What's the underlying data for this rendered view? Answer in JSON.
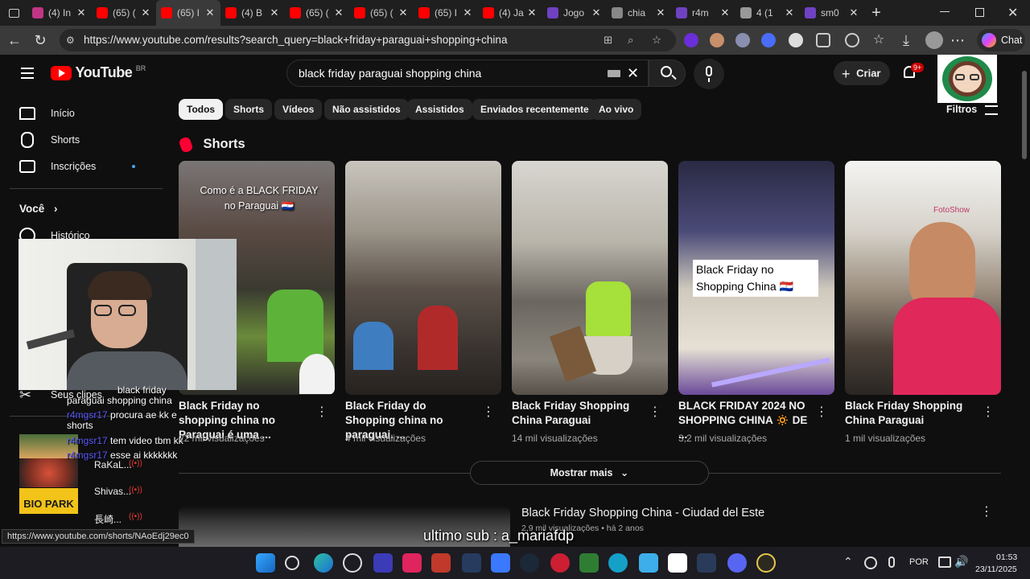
{
  "browser": {
    "tabs": [
      {
        "title": "(4) In",
        "color": "#c13584",
        "active": false
      },
      {
        "title": "(65) (",
        "color": "#ff0000",
        "active": false
      },
      {
        "title": "(65) I",
        "color": "#ff0000",
        "active": true
      },
      {
        "title": "(4) B",
        "color": "#ff0000",
        "active": false
      },
      {
        "title": "(65) (",
        "color": "#ff0000",
        "active": false
      },
      {
        "title": "(65) (",
        "color": "#ff0000",
        "active": false
      },
      {
        "title": "(65) I",
        "color": "#ff0000",
        "active": false
      },
      {
        "title": "(4) Ja",
        "color": "#ff0000",
        "active": false
      },
      {
        "title": "Jogo",
        "color": "#6f42c1",
        "active": false
      },
      {
        "title": "chia",
        "color": "#888888",
        "active": false
      },
      {
        "title": "r4m",
        "color": "#6f42c1",
        "active": false
      },
      {
        "title": "4 (1",
        "color": "#999999",
        "active": false
      },
      {
        "title": "sm0",
        "color": "#6f42c1",
        "active": false
      }
    ],
    "url": "https://www.youtube.com/results?search_query=black+friday+paraguai+shopping+china",
    "chat_button": "Chat"
  },
  "youtube": {
    "logo_text": "YouTube",
    "region": "BR",
    "search_query": "black friday paraguai shopping china",
    "create_label": "Criar",
    "notif_badge": "9+",
    "filters_label": "Filtros",
    "chips": [
      "Todos",
      "Shorts",
      "Vídeos",
      "Não assistidos",
      "Assistidos",
      "Enviados recentemente",
      "Ao vivo"
    ],
    "sidebar": {
      "home": "Início",
      "shorts": "Shorts",
      "subs": "Inscrições",
      "you": "Você",
      "history": "Histórico",
      "clips": "Seus clipes",
      "subs_list": [
        {
          "name": "RaKaL..."
        },
        {
          "name": "Shivas..."
        },
        {
          "name": "長崎..."
        }
      ]
    },
    "shorts_heading": "Shorts",
    "shorts": [
      {
        "title": "Black Friday no shopping china no Paraguai é uma ...",
        "views": "22 mil visualizações",
        "overlay": "Como é a BLACK FRIDAY no Paraguai 🇵🇾"
      },
      {
        "title": "Black Friday do Shopping china no paraguai. ...",
        "views": "4 mil visualizações",
        "overlay": ""
      },
      {
        "title": "Black Friday Shopping China Paraguai",
        "views": "14 mil visualizações",
        "overlay": ""
      },
      {
        "title": "BLACK FRIDAY 2024 NO SHOPPING CHINA 🔅 DE ...",
        "views": "3,2 mil visualizações",
        "overlay": "Black Friday no Shopping China 🇵🇾"
      },
      {
        "title": "Black Friday Shopping China Paraguai",
        "views": "1 mil visualizações",
        "overlay": ""
      }
    ],
    "show_more": "Mostrar mais",
    "video": {
      "title": "Black Friday Shopping China - Ciudad del Este",
      "meta": "2,9 mil visualizações • há 2 anos"
    },
    "status_url": "https://www.youtube.com/shorts/NAoEdj29ec0"
  },
  "overlay": {
    "chat": [
      {
        "user": "",
        "text": "black friday"
      },
      {
        "user": "",
        "text": "paraguai shopping china"
      },
      {
        "user": "r4mgsr17",
        "text": "procura ae kk e"
      },
      {
        "user": "",
        "text": "shorts"
      },
      {
        "user": "r4mgsr17",
        "text": "tem video tbm kk"
      },
      {
        "user": "r4mgsr17",
        "text": "esse ai kkkkkkk"
      }
    ],
    "caption": "ultimo sub : a_mariafdp"
  },
  "taskbar": {
    "lang": "POR",
    "time": "01:53",
    "date": "23/11/2025"
  }
}
